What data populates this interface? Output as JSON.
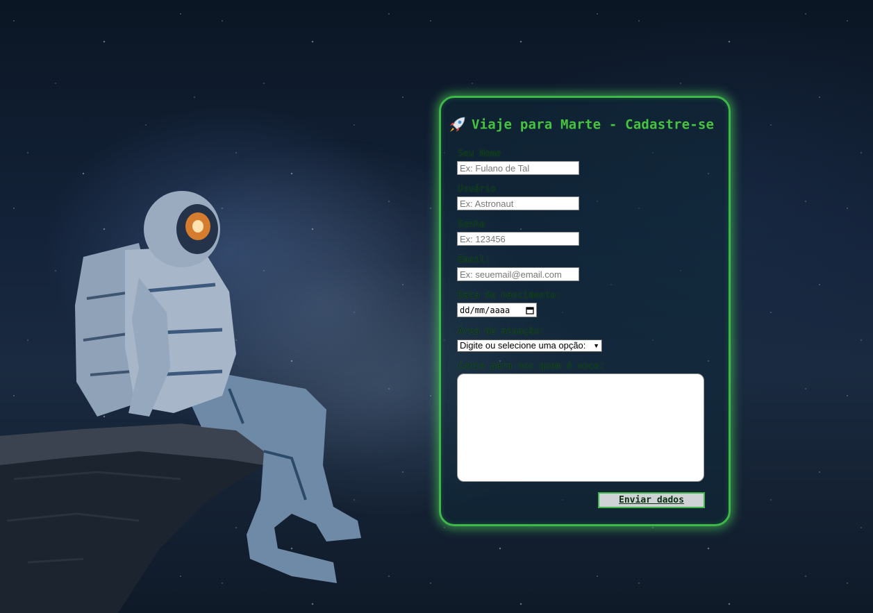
{
  "form": {
    "title": "Viaje para Marte - Cadastre-se",
    "title_icon": "rocket-icon",
    "fields": {
      "name": {
        "label": "Seu Nome",
        "placeholder": "Ex: Fulano de Tal"
      },
      "username": {
        "label": "Usuário",
        "placeholder": "Ex: Astronaut"
      },
      "password": {
        "label": "Senha",
        "placeholder": "Ex: 123456"
      },
      "email": {
        "label": "Email:",
        "placeholder": "Ex: seuemail@email.com"
      },
      "birthdate": {
        "label": "Data de nascimento:",
        "value": "dd/mm/aaaa",
        "icon": "calendar-icon"
      },
      "area": {
        "label": "Área de atuação:",
        "selected": "Digite ou selecione uma opção:"
      },
      "about": {
        "label": "Conte para nos quem é voce:",
        "value": ""
      }
    },
    "submit_label": "Enviar dados"
  },
  "colors": {
    "accent": "#3fb84a",
    "title": "#46c43f",
    "card_bg": "#0f2837"
  }
}
